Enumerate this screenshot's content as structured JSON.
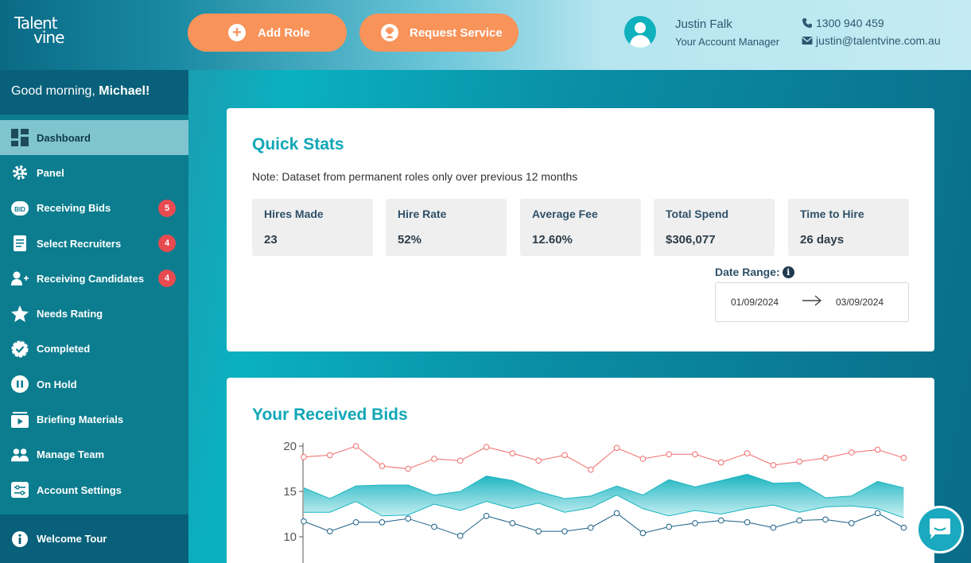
{
  "header": {
    "logo_line1": "Talent",
    "logo_line2": "vine",
    "add_role_label": "Add Role",
    "request_service_label": "Request Service",
    "manager_name": "Justin Falk",
    "manager_role": "Your Account Manager",
    "phone": "1300 940 459",
    "email": "justin@talentvine.com.au"
  },
  "sidebar": {
    "greeting_prefix": "Good morning, ",
    "greeting_name": "Michael!",
    "items": [
      {
        "label": "Dashboard",
        "icon": "dashboard-icon",
        "badge": ""
      },
      {
        "label": "Panel",
        "icon": "gear-icon",
        "badge": ""
      },
      {
        "label": "Receiving Bids",
        "icon": "bid-icon",
        "badge": "5"
      },
      {
        "label": "Select Recruiters",
        "icon": "document-icon",
        "badge": "4"
      },
      {
        "label": "Receiving Candidates",
        "icon": "user-add-icon",
        "badge": "4"
      },
      {
        "label": "Needs Rating",
        "icon": "star-icon",
        "badge": ""
      },
      {
        "label": "Completed",
        "icon": "check-badge-icon",
        "badge": ""
      },
      {
        "label": "On Hold",
        "icon": "pause-icon",
        "badge": ""
      },
      {
        "label": "Briefing Materials",
        "icon": "video-folder-icon",
        "badge": ""
      },
      {
        "label": "Manage Team",
        "icon": "team-icon",
        "badge": ""
      },
      {
        "label": "Account Settings",
        "icon": "sliders-icon",
        "badge": ""
      }
    ],
    "tour_label": "Welcome Tour"
  },
  "quick_stats": {
    "title": "Quick Stats",
    "note": "Note: Dataset from permanent roles only over previous 12 months",
    "stats": [
      {
        "label": "Hires Made",
        "value": "23"
      },
      {
        "label": "Hire Rate",
        "value": "52%"
      },
      {
        "label": "Average Fee",
        "value": "12.60%"
      },
      {
        "label": "Total Spend",
        "value": "$306,077"
      },
      {
        "label": "Time to Hire",
        "value": "26 days"
      }
    ],
    "date_range_label": "Date Range:",
    "date_from": "01/09/2024",
    "date_to": "03/09/2024"
  },
  "bids": {
    "title": "Your Received Bids"
  },
  "colors": {
    "accent": "#11a7b7",
    "orange": "#f8935a",
    "badge": "#e74a4f",
    "max_line": "#f06c6c",
    "min_line": "#1a5f86",
    "band": "#18b4c0"
  },
  "chart_data": {
    "type": "line",
    "ylim": [
      10,
      20
    ],
    "yticks": [
      "20",
      "15",
      "10"
    ],
    "series": [
      {
        "role": "max",
        "values": [
          18.8,
          19.0,
          20.0,
          17.8,
          17.5,
          18.6,
          18.4,
          19.9,
          19.2,
          18.4,
          19.0,
          17.4,
          19.8,
          18.6,
          19.1,
          19.1,
          18.2,
          19.2,
          17.9,
          18.3,
          18.7,
          19.3,
          19.6,
          18.7
        ]
      },
      {
        "role": "upper",
        "values": [
          15.4,
          14.2,
          15.6,
          15.7,
          15.7,
          14.6,
          15.0,
          16.7,
          16.2,
          15.0,
          14.2,
          14.5,
          15.6,
          14.6,
          16.3,
          15.5,
          16.2,
          16.9,
          15.9,
          16.0,
          14.3,
          14.5,
          16.1,
          15.4
        ]
      },
      {
        "role": "lower",
        "values": [
          12.7,
          12.7,
          13.9,
          12.3,
          12.4,
          13.6,
          12.9,
          13.9,
          13.1,
          13.7,
          12.7,
          13.2,
          14.6,
          13.1,
          12.3,
          12.9,
          12.5,
          13.1,
          13.5,
          12.7,
          13.3,
          13.4,
          13.1,
          12.1
        ]
      },
      {
        "role": "min",
        "values": [
          11.7,
          10.6,
          11.6,
          11.6,
          12.0,
          11.1,
          10.1,
          12.3,
          11.5,
          10.6,
          10.6,
          11.0,
          12.6,
          10.4,
          11.1,
          11.5,
          11.8,
          11.6,
          11.0,
          11.8,
          11.9,
          11.5,
          12.6,
          11.0
        ]
      }
    ]
  }
}
